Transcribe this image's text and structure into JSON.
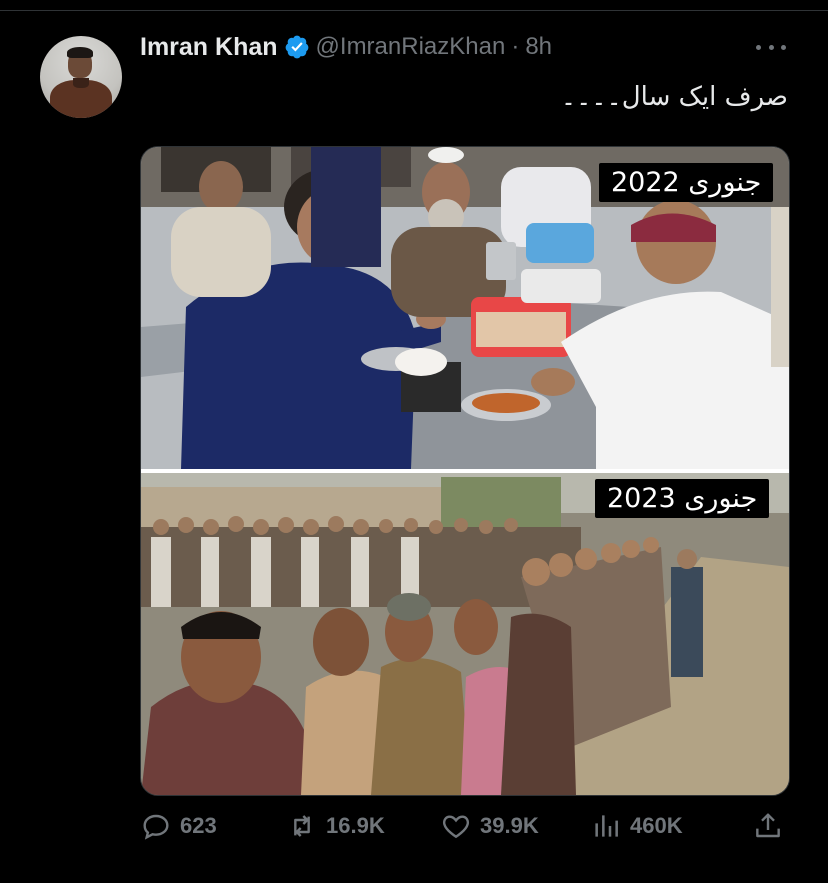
{
  "author": {
    "name": "Imran Khan",
    "handle": "@ImranRiazKhan",
    "separator": "·",
    "time": "8h",
    "verified": true
  },
  "tweet": {
    "text": "صرف ایک سال۔۔۔۔"
  },
  "media": {
    "top_label": "جنوری 2022",
    "bottom_label": "جنوری 2023"
  },
  "actions": {
    "replies": "623",
    "retweets": "16.9K",
    "likes": "39.9K",
    "views": "460K"
  },
  "icons": {
    "verified": "verified-badge-icon",
    "more": "more-icon",
    "reply": "reply-icon",
    "retweet": "retweet-icon",
    "like": "heart-icon",
    "views": "views-icon",
    "share": "share-icon"
  },
  "colors": {
    "background": "#000000",
    "primary_text": "#e7e9ea",
    "secondary_text": "#71767b",
    "verified_blue": "#1d9bf0",
    "divider": "#2f3336"
  }
}
